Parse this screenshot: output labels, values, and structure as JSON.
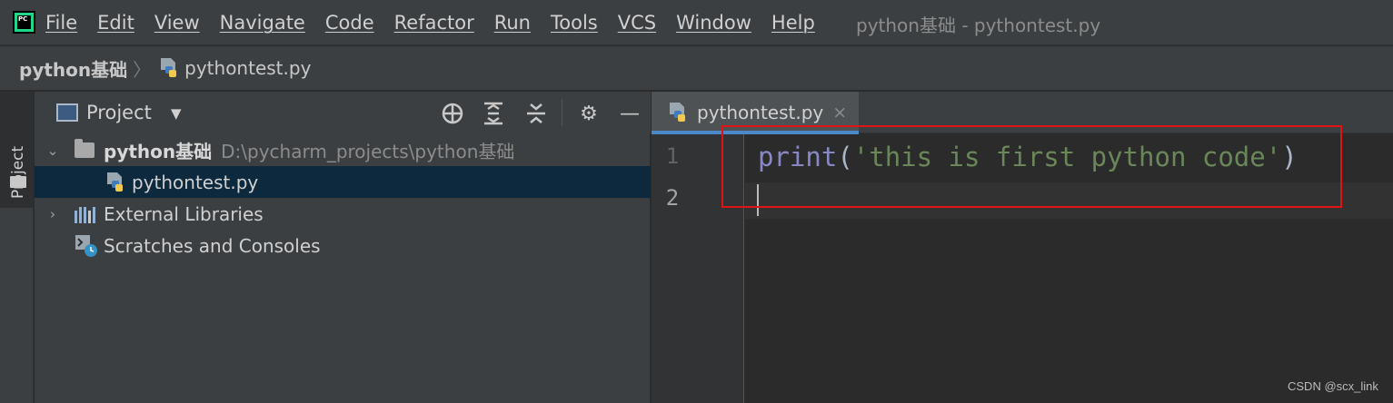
{
  "menubar": {
    "logo_text": "PC",
    "items": [
      "File",
      "Edit",
      "View",
      "Navigate",
      "Code",
      "Refactor",
      "Run",
      "Tools",
      "VCS",
      "Window",
      "Help"
    ],
    "window_title": "python基础 - pythontest.py"
  },
  "breadcrumb": {
    "root": "python基础",
    "separator": "〉",
    "file": "pythontest.py"
  },
  "tool_stripe": {
    "project_label": "Project"
  },
  "project_panel": {
    "title": "Project",
    "dropdown_arrow": "▼",
    "tools": {
      "locate": "⊕",
      "expand_all": "⇕",
      "collapse_all": "⇔",
      "settings": "⚙",
      "hide": "—"
    },
    "tree": {
      "root_arrow": "⌄",
      "root_name": "python基础",
      "root_path": "D:\\pycharm_projects\\python基础",
      "file_name": "pythontest.py",
      "ext_arrow": "›",
      "external_libraries": "External Libraries",
      "scratches": "Scratches and Consoles"
    }
  },
  "editor": {
    "tab_label": "pythontest.py",
    "tab_close": "×",
    "line_numbers": [
      "1",
      "2"
    ],
    "code": {
      "fn": "print",
      "open_paren": "(",
      "string": "'this is first python code'",
      "close_paren": ")"
    }
  },
  "colors": {
    "accent": "#4a88c7",
    "highlight_box": "#e01414",
    "selection": "#0d293e"
  },
  "watermark": "CSDN @scx_link"
}
